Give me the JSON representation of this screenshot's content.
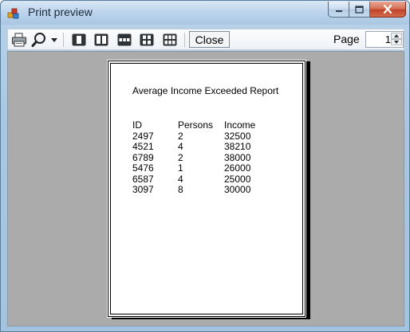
{
  "window": {
    "title": "Print preview"
  },
  "toolbar": {
    "icons": [
      "printer-icon",
      "zoom-magnifier-icon",
      "dropdown-arrow-icon",
      "one-page-icon",
      "two-pages-icon",
      "three-pages-icon",
      "four-pages-icon",
      "six-pages-icon"
    ],
    "close_label": "Close",
    "page_label": "Page",
    "page_value": "1"
  },
  "report": {
    "title": "Average Income Exceeded Report",
    "columns": [
      "ID",
      "Persons",
      "Income"
    ],
    "rows": [
      [
        "2497",
        "2",
        "32500"
      ],
      [
        "4521",
        "4",
        "38210"
      ],
      [
        "6789",
        "2",
        "38000"
      ],
      [
        "5476",
        "1",
        "26000"
      ],
      [
        "6587",
        "4",
        "25000"
      ],
      [
        "3097",
        "8",
        "30000"
      ]
    ]
  }
}
